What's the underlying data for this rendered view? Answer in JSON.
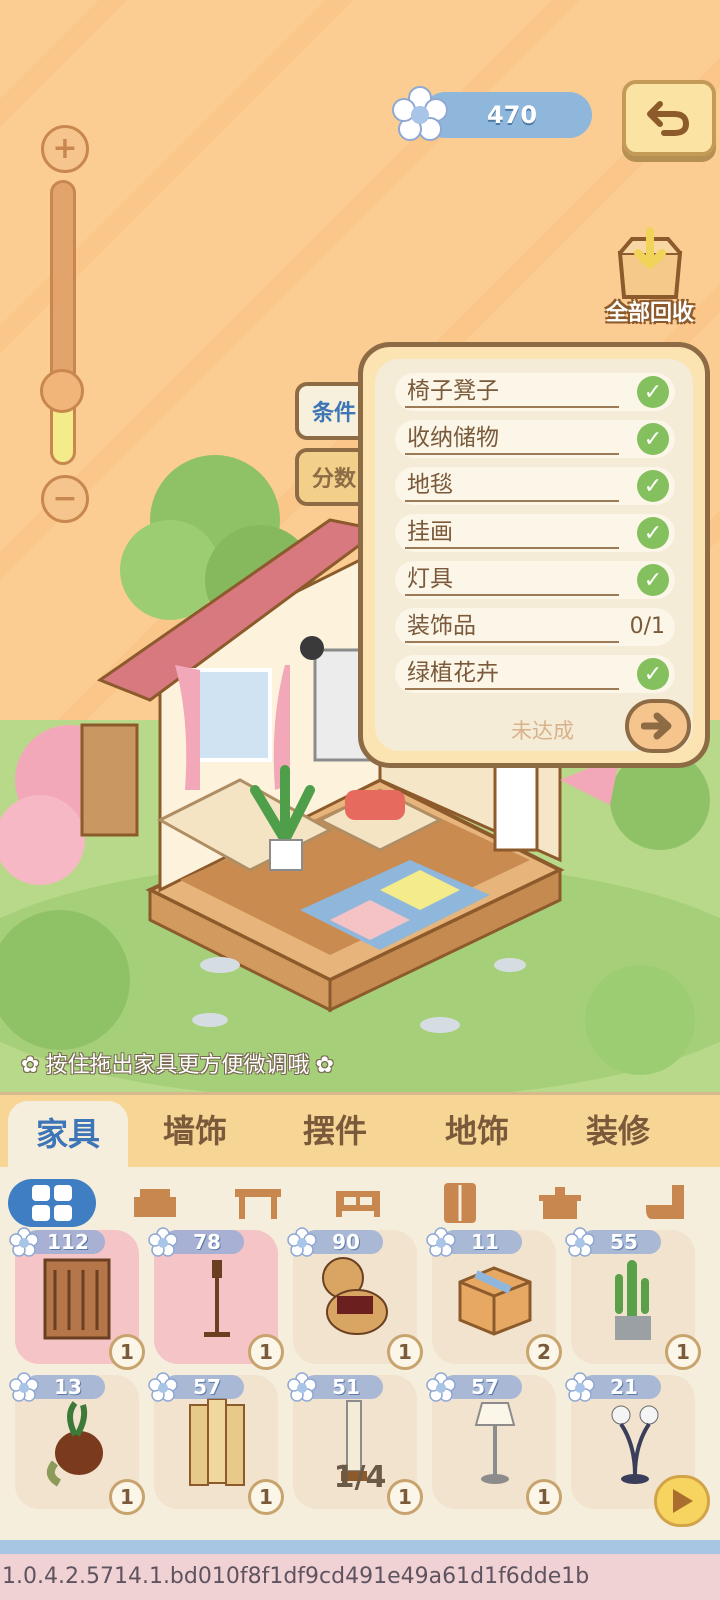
{
  "currency": {
    "amount": "470",
    "icon": "flower-icon"
  },
  "zoom": {
    "level": 0.26
  },
  "recycle": {
    "label": "全部回收"
  },
  "panel": {
    "tabs": {
      "conditions": "条件",
      "score": "分数"
    },
    "conditions": [
      {
        "name": "椅子凳子",
        "done": true
      },
      {
        "name": "收纳储物",
        "done": true
      },
      {
        "name": "地毯",
        "done": true
      },
      {
        "name": "挂画",
        "done": true
      },
      {
        "name": "灯具",
        "done": true
      },
      {
        "name": "装饰品",
        "done": false,
        "progress": "0/1"
      },
      {
        "name": "绿植花卉",
        "done": true
      }
    ],
    "status": "未达成"
  },
  "hint": "按住拖出家具更方便微调哦",
  "categories": [
    "家具",
    "墙饰",
    "摆件",
    "地饰",
    "装修"
  ],
  "subcategories": [
    "all-icon",
    "sofa-icon",
    "table-icon",
    "bed-icon",
    "wardrobe-icon",
    "stove-icon",
    "toilet-icon"
  ],
  "items": [
    {
      "price": "112",
      "qty": "1",
      "name": "screen"
    },
    {
      "price": "78",
      "qty": "1",
      "name": "floor-lamp"
    },
    {
      "price": "90",
      "qty": "1",
      "name": "teddy-bear"
    },
    {
      "price": "11",
      "qty": "2",
      "name": "cardboard-box"
    },
    {
      "price": "55",
      "qty": "1",
      "name": "cactus"
    },
    {
      "price": "13",
      "qty": "1",
      "name": "potted-plant"
    },
    {
      "price": "57",
      "qty": "1",
      "name": "folding-screen"
    },
    {
      "price": "51",
      "qty": "1",
      "name": "tall-lamp"
    },
    {
      "price": "57",
      "qty": "1",
      "name": "standing-lamp"
    },
    {
      "price": "21",
      "qty": "1",
      "name": "globe-lamp"
    }
  ],
  "page": "1/4",
  "version": "1.0.4.2.5714.1.bd010f8f1df9cd491e49a61d1f6dde1b"
}
